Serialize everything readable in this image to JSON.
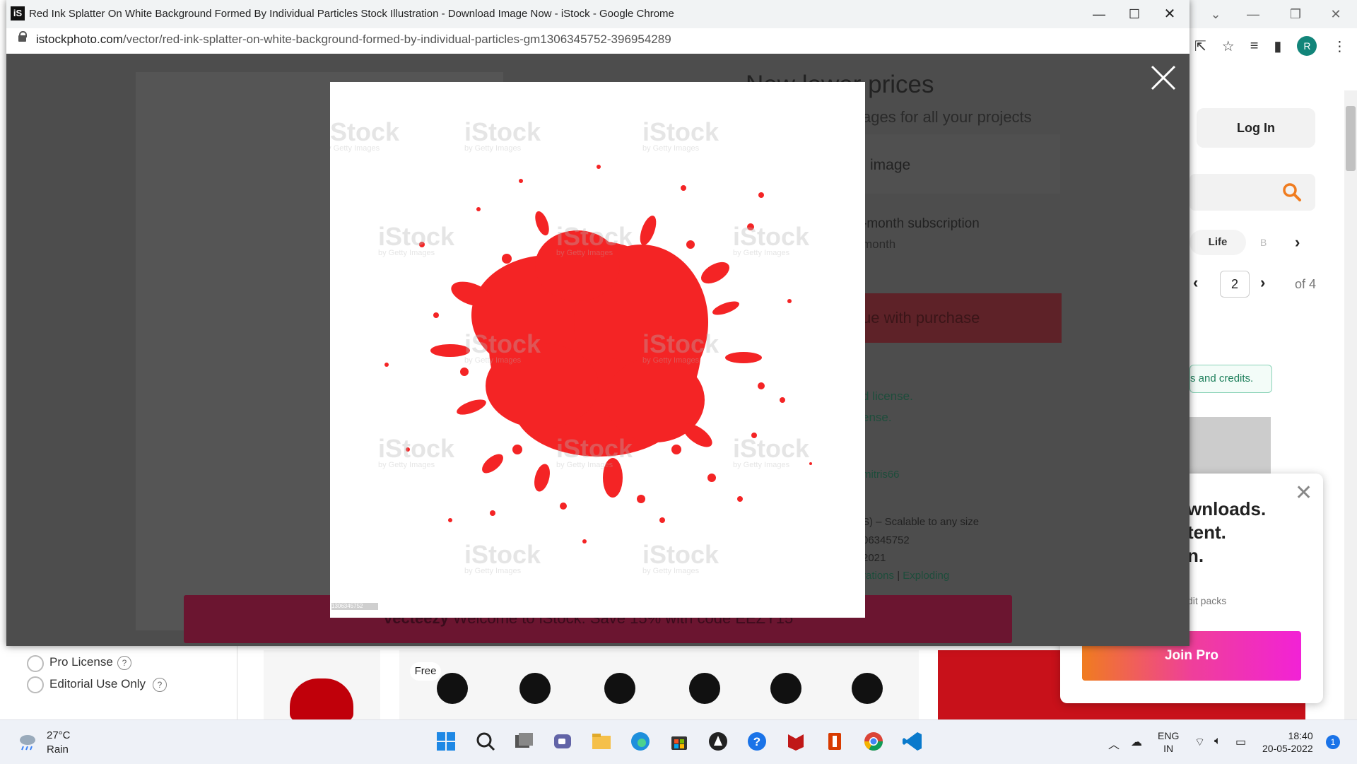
{
  "window": {
    "title": "Red Ink Splatter On White Background Formed By Individual Particles Stock Illustration - Download Image Now - iStock - Google Chrome",
    "favicon_text": "iS",
    "url_domain": "istockphoto.com",
    "url_path": "/vector/red-ink-splatter-on-white-background-formed-by-individual-particles-gm1306345752-396954289",
    "minimize_glyph": "—",
    "maximize_glyph": "☐",
    "close_glyph": "✕"
  },
  "background_page": {
    "login_label": "Log In",
    "tags": [
      "Life",
      "B"
    ],
    "pager": {
      "current": "2",
      "of_label": "of 4"
    },
    "credits_text": "s and credits.",
    "avatar_letter": "R",
    "filters": {
      "pro_license": "Pro License",
      "editorial_use_only": "Editorial Use Only"
    },
    "popup": {
      "line1": "wnloads.",
      "line2": "tent.",
      "line3": "n.",
      "small_text": "dit packs",
      "join_label": "Join Pro"
    },
    "free_badge": "Free",
    "promo_text": "Welcome to iStock. Save 15% with code EEZY15",
    "promo_brand": "vecteezy",
    "behind_modal": {
      "price_title": "New lower prices",
      "price_sub": "ages for all your projects",
      "option_image": "image",
      "subscription": "-month subscription",
      "month": "month",
      "continue_btn": "ue with purchase",
      "license1": "d license.",
      "license2": "ense.",
      "author": "mitris66",
      "scalable": "S) – Scalable to any size",
      "image_id": "06345752",
      "year": "2021",
      "tags_prefix": "rations",
      "tags_sep": "|",
      "tag_exploding": "Exploding"
    }
  },
  "modal": {
    "close_label": "close",
    "watermark": "iStock",
    "watermark_sub": "by Getty Images",
    "image_id_badge": "1306345752",
    "accent_red": "#f42425"
  },
  "taskbar": {
    "weather_temp": "27°C",
    "weather_desc": "Rain",
    "lang_line1": "ENG",
    "lang_line2": "IN",
    "time": "18:40",
    "date": "20-05-2022",
    "notification_count": "1"
  }
}
